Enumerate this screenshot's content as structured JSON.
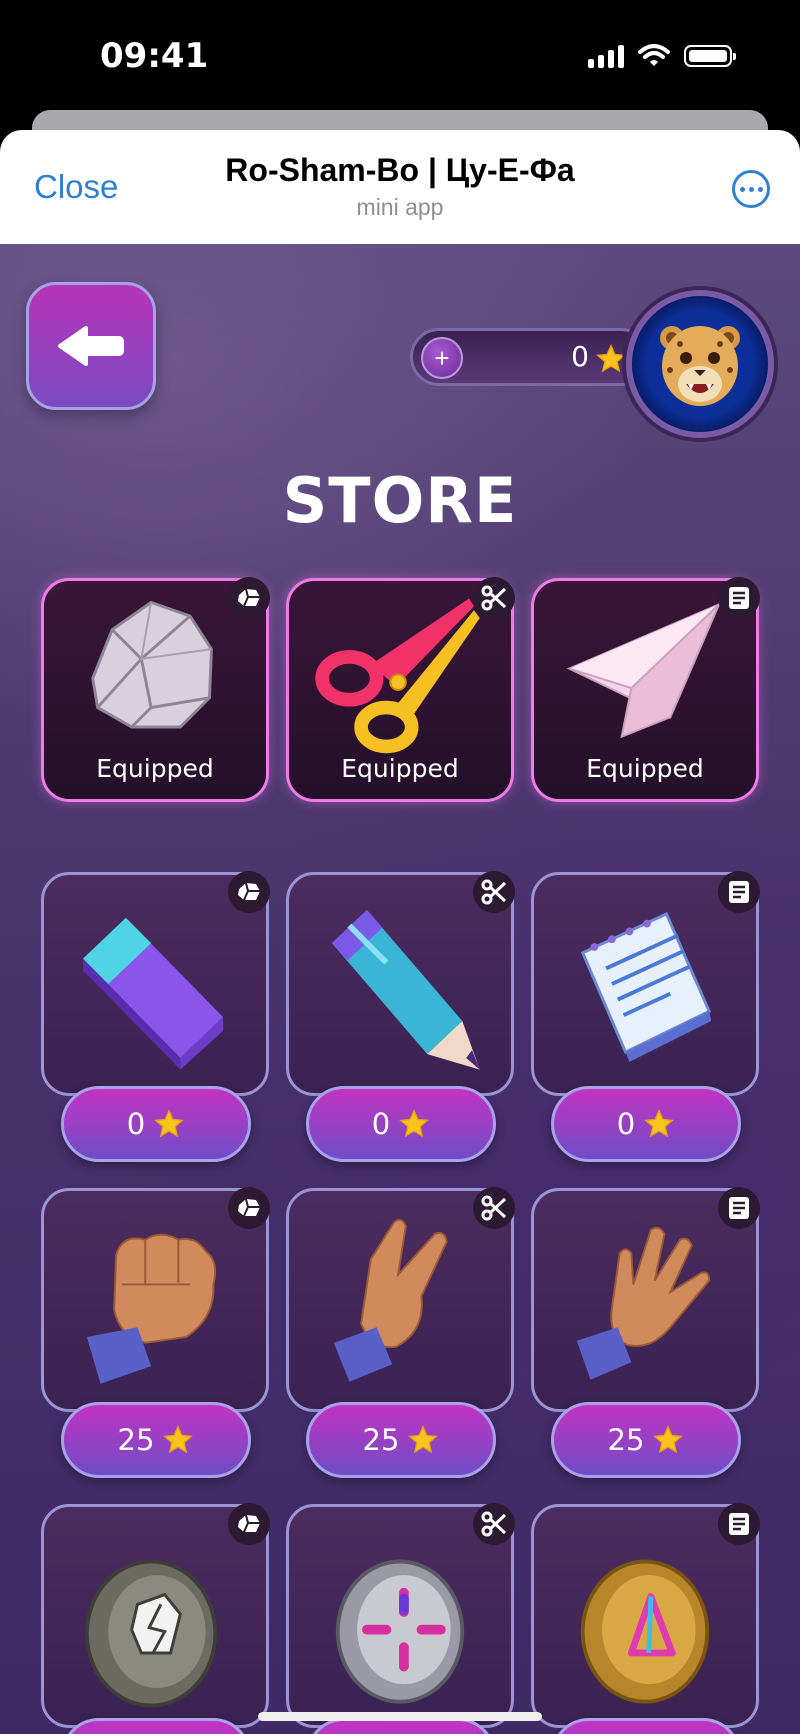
{
  "status_bar": {
    "time": "09:41"
  },
  "telegram_header": {
    "close_label": "Close",
    "title": "Ro-Sham-Bo | Цу-Е-Фа",
    "subtitle": "mini app"
  },
  "app": {
    "balance": "0",
    "store_title": "STORE",
    "equipped_items": [
      {
        "category": "rock",
        "label": "Equipped"
      },
      {
        "category": "scissors",
        "label": "Equipped"
      },
      {
        "category": "paper",
        "label": "Equipped"
      }
    ],
    "shop_rows": [
      {
        "items": [
          {
            "category": "rock",
            "icon": "eraser-icon",
            "price": "0"
          },
          {
            "category": "scissors",
            "icon": "pencil-icon",
            "price": "0"
          },
          {
            "category": "paper",
            "icon": "notepad-icon",
            "price": "0"
          }
        ]
      },
      {
        "items": [
          {
            "category": "rock",
            "icon": "fist-icon",
            "price": "25"
          },
          {
            "category": "scissors",
            "icon": "peace-hand-icon",
            "price": "25"
          },
          {
            "category": "paper",
            "icon": "open-hand-icon",
            "price": "25"
          }
        ]
      },
      {
        "items": [
          {
            "category": "rock",
            "icon": "rock-coin-icon"
          },
          {
            "category": "scissors",
            "icon": "silver-coin-icon"
          },
          {
            "category": "paper",
            "icon": "gold-coin-icon"
          }
        ]
      }
    ]
  }
}
